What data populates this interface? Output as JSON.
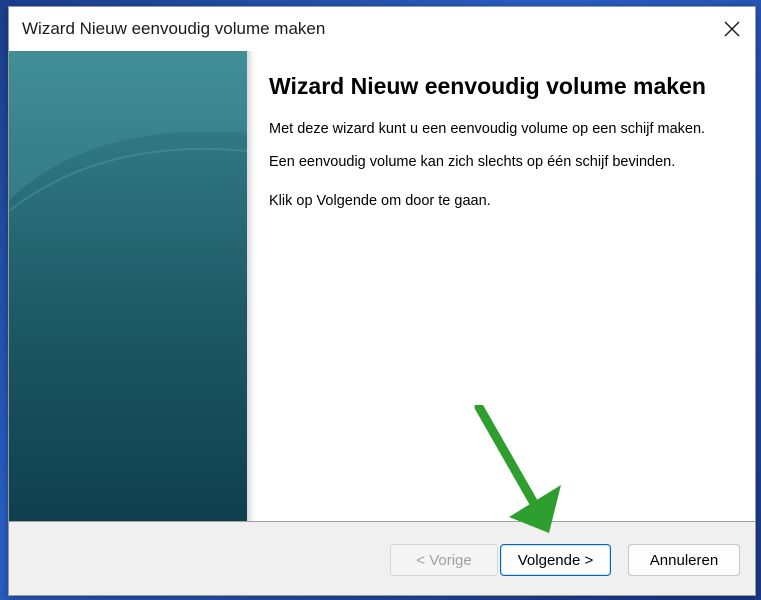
{
  "window": {
    "title": "Wizard Nieuw eenvoudig volume maken"
  },
  "main": {
    "heading": "Wizard Nieuw eenvoudig volume maken",
    "paragraphs": [
      "Met deze wizard kunt u een eenvoudig volume op een schijf maken.",
      "Een eenvoudig volume kan zich slechts op één schijf bevinden.",
      "Klik op Volgende om door te gaan."
    ]
  },
  "footer": {
    "back_label": "< Vorige",
    "next_label": "Volgende >",
    "cancel_label": "Annuleren"
  },
  "icons": {
    "close": "close-icon",
    "annotation": "green-arrow-icon"
  },
  "colors": {
    "side_panel": "#1e5a66",
    "accent": "#0067c0",
    "annotation_arrow": "#2e9e2e",
    "footer": "#f0f0f0"
  }
}
